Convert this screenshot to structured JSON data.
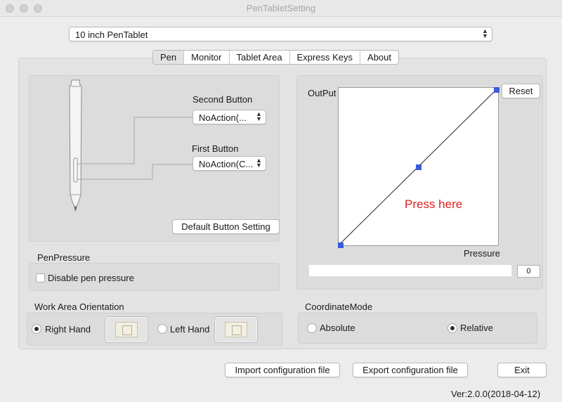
{
  "window": {
    "title": "PenTabletSetting"
  },
  "device": {
    "selected": "10 inch PenTablet"
  },
  "tabs": [
    {
      "label": "Pen",
      "active": true
    },
    {
      "label": "Monitor",
      "active": false
    },
    {
      "label": "Tablet Area",
      "active": false
    },
    {
      "label": "Express Keys",
      "active": false
    },
    {
      "label": "About",
      "active": false
    }
  ],
  "pen_buttons": {
    "second_button": {
      "label": "Second Button",
      "value": "NoAction(..."
    },
    "first_button": {
      "label": "First Button",
      "value": "NoAction(C..."
    },
    "default_setting_label": "Default  Button Setting"
  },
  "pressure_curve": {
    "output_label": "OutPut",
    "pressure_label": "Pressure",
    "reset_label": "Reset",
    "prompt": "Press here",
    "value": "0",
    "accent": "#3b5bd9",
    "prompt_color": "#e0201e"
  },
  "pen_pressure": {
    "section_title": "PenPressure",
    "disable_label": "Disable pen pressure",
    "disabled": false
  },
  "work_area_orientation": {
    "section_title": "Work Area Orientation",
    "options": [
      {
        "label": "Right Hand",
        "selected": true
      },
      {
        "label": "Left Hand",
        "selected": false
      }
    ]
  },
  "coordinate_mode": {
    "section_title": "CoordinateMode",
    "options": [
      {
        "label": "Absolute",
        "selected": false
      },
      {
        "label": "Relative",
        "selected": true
      }
    ]
  },
  "footer": {
    "import_label": "Import configuration file",
    "export_label": "Export configuration file",
    "exit_label": "Exit",
    "version": "Ver:2.0.0(2018-04-12)"
  }
}
